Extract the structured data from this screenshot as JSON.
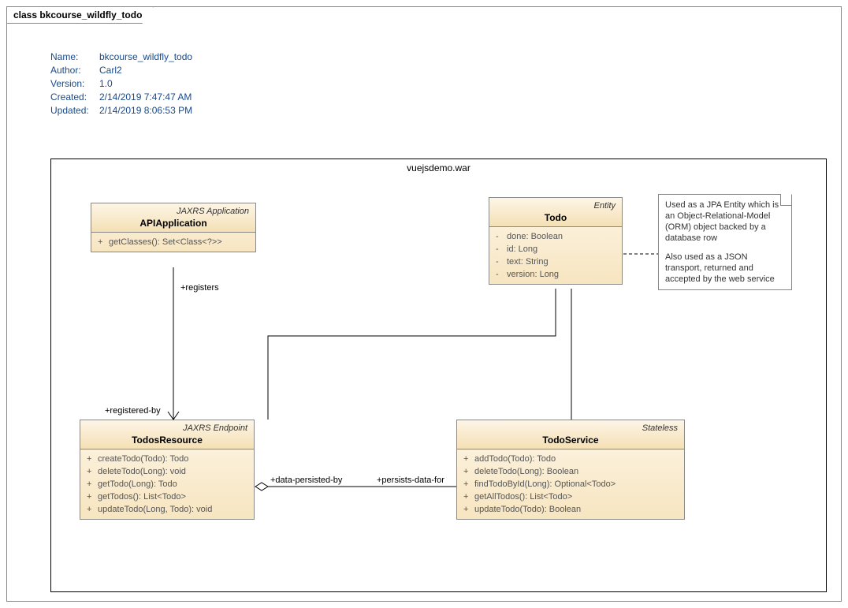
{
  "diagram": {
    "title_prefix": "class",
    "title_name": "bkcourse_wildfly_todo"
  },
  "meta": {
    "name_label": "Name:",
    "name_value": "bkcourse_wildfly_todo",
    "author_label": "Author:",
    "author_value": "Carl2",
    "version_label": "Version:",
    "version_value": "1.0",
    "created_label": "Created:",
    "created_value": "2/14/2019 7:47:47 AM",
    "updated_label": "Updated:",
    "updated_value": "2/14/2019 8:06:53 PM"
  },
  "package": {
    "name": "vuejsdemo.war"
  },
  "classes": {
    "apiApp": {
      "stereotype": "JAXRS Application",
      "name": "APIApplication",
      "ops": [
        {
          "vis": "+",
          "sig": "getClasses(): Set<Class<?>>"
        }
      ]
    },
    "todo": {
      "stereotype": "Entity",
      "name": "Todo",
      "attrs": [
        {
          "vis": "-",
          "sig": "done: Boolean"
        },
        {
          "vis": "-",
          "sig": "id: Long"
        },
        {
          "vis": "-",
          "sig": "text: String"
        },
        {
          "vis": "-",
          "sig": "version: Long"
        }
      ]
    },
    "todosResource": {
      "stereotype": "JAXRS Endpoint",
      "name": "TodosResource",
      "ops": [
        {
          "vis": "+",
          "sig": "createTodo(Todo): Todo"
        },
        {
          "vis": "+",
          "sig": "deleteTodo(Long): void"
        },
        {
          "vis": "+",
          "sig": "getTodo(Long): Todo"
        },
        {
          "vis": "+",
          "sig": "getTodos(): List<Todo>"
        },
        {
          "vis": "+",
          "sig": "updateTodo(Long, Todo): void"
        }
      ]
    },
    "todoService": {
      "stereotype": "Stateless",
      "name": "TodoService",
      "ops": [
        {
          "vis": "+",
          "sig": "addTodo(Todo): Todo"
        },
        {
          "vis": "+",
          "sig": "deleteTodo(Long): Boolean"
        },
        {
          "vis": "+",
          "sig": "findTodoById(Long): Optional<Todo>"
        },
        {
          "vis": "+",
          "sig": "getAllTodos(): List<Todo>"
        },
        {
          "vis": "+",
          "sig": "updateTodo(Todo): Boolean"
        }
      ]
    }
  },
  "note": {
    "p1": "Used as a JPA Entity which is an Object-Relational-Model (ORM) object backed by a database row",
    "p2": "Also used as a JSON transport, returned and accepted by the web service"
  },
  "labels": {
    "registers": "+registers",
    "registered_by": "+registered-by",
    "data_persisted_by": "+data-persisted-by",
    "persists_data_for": "+persists-data-for"
  }
}
